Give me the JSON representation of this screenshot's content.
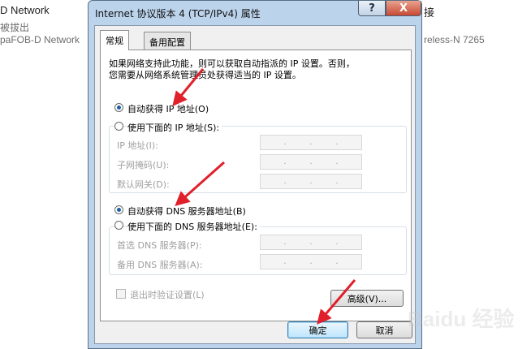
{
  "background": {
    "line1": "D Network",
    "line2": "被拔出",
    "line3": "paFOB-D Network",
    "right1": "接",
    "right2": "reless-N 7265"
  },
  "dialog": {
    "title": "Internet 协议版本 4 (TCP/IPv4) 属性",
    "help": "?",
    "close": "X",
    "tabs": [
      "常规",
      "备用配置"
    ],
    "intro_line1": "如果网络支持此功能，则可以获取自动指派的 IP 设置。否则，",
    "intro_line2": "您需要从网络系统管理员处获得适当的 IP 设置。",
    "auto_ip": "自动获得 IP 地址(O)",
    "manual_ip": "使用下面的 IP 地址(S):",
    "ip_label": "IP 地址(I):",
    "mask_label": "子网掩码(U):",
    "gateway_label": "默认网关(D):",
    "auto_dns": "自动获得 DNS 服务器地址(B)",
    "manual_dns": "使用下面的 DNS 服务器地址(E):",
    "pref_dns": "首选 DNS 服务器(P):",
    "alt_dns": "备用 DNS 服务器(A):",
    "validate": "退出时验证设置(L)",
    "advanced": "高级(V)...",
    "ok": "确定",
    "cancel": "取消"
  },
  "watermark": "Baidu 经验",
  "colors": {
    "accent": "#1c5fa3",
    "arrow": "#e0202a",
    "titlebar": "#bcd3ec"
  }
}
